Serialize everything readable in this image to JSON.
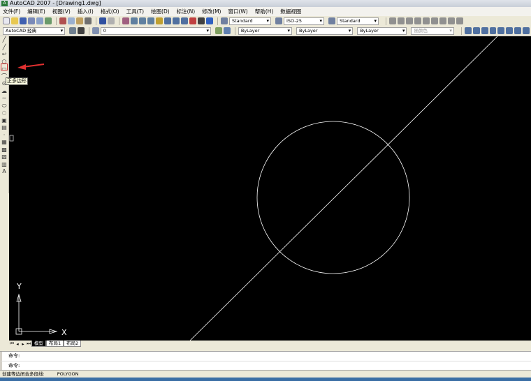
{
  "window": {
    "title": "AutoCAD 2007 - [Drawing1.dwg]"
  },
  "menu": [
    "文件(F)",
    "编辑(E)",
    "视图(V)",
    "插入(I)",
    "格式(O)",
    "工具(T)",
    "绘图(D)",
    "标注(N)",
    "修改(M)",
    "窗口(W)",
    "帮助(H)",
    "数据视图"
  ],
  "toolbar": {
    "text_style": "Standard",
    "dim_style": "ISO-25",
    "table_style": "Standard",
    "workspace": "AutoCAD 经典",
    "layer": "0",
    "color": "ByLayer",
    "linetype": "ByLayer",
    "lineweight": "ByLayer",
    "plot_style": "随颜色"
  },
  "draw_toolbar": {
    "tooltip": "正多边形",
    "active_tool": "polygon"
  },
  "layout_tabs": [
    "模型",
    "布局1",
    "布局2"
  ],
  "command": {
    "lines": [
      "命令:",
      "命令:"
    ]
  },
  "status": {
    "prompt": "创建等边闭合多段线:",
    "command": "POLYGON"
  },
  "ucs": {
    "x_label": "X",
    "y_label": "Y"
  },
  "colors": {
    "canvas": "#000000",
    "geometry": "#ffffff",
    "arrow": "#e03030"
  }
}
